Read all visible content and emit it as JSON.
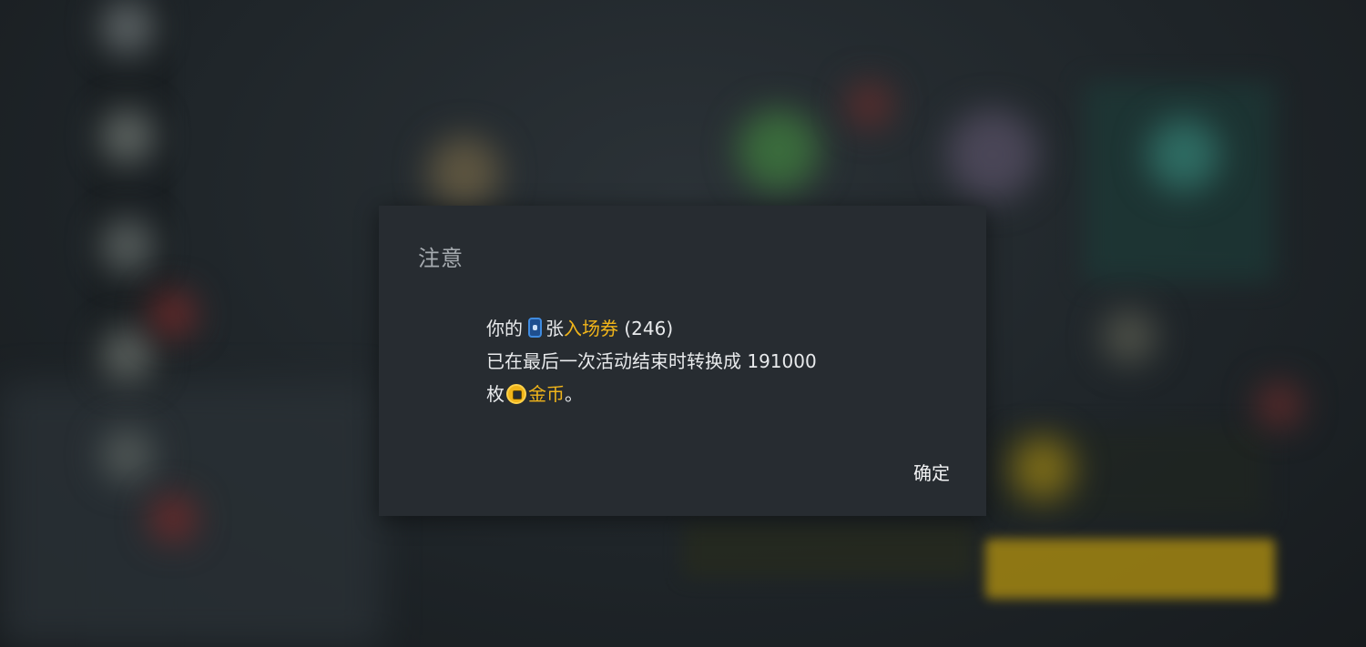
{
  "dialog": {
    "title": "注意",
    "body": {
      "line1_prefix": "你的",
      "ticket_icon": "ticket-icon",
      "line1_unit": "张",
      "ticket_name": "入场券",
      "ticket_count": "(246)",
      "line2": "已在最后一次活动结束时转换成 191000",
      "line3_prefix": "枚",
      "coin_icon": "coin-icon",
      "coin_name": "金币",
      "line3_suffix": "。"
    },
    "confirm_label": "确定"
  },
  "colors": {
    "highlight": "#f1b51a",
    "dialog_bg": "#272c31",
    "title": "#a6abb0",
    "text": "#e8eaec"
  }
}
